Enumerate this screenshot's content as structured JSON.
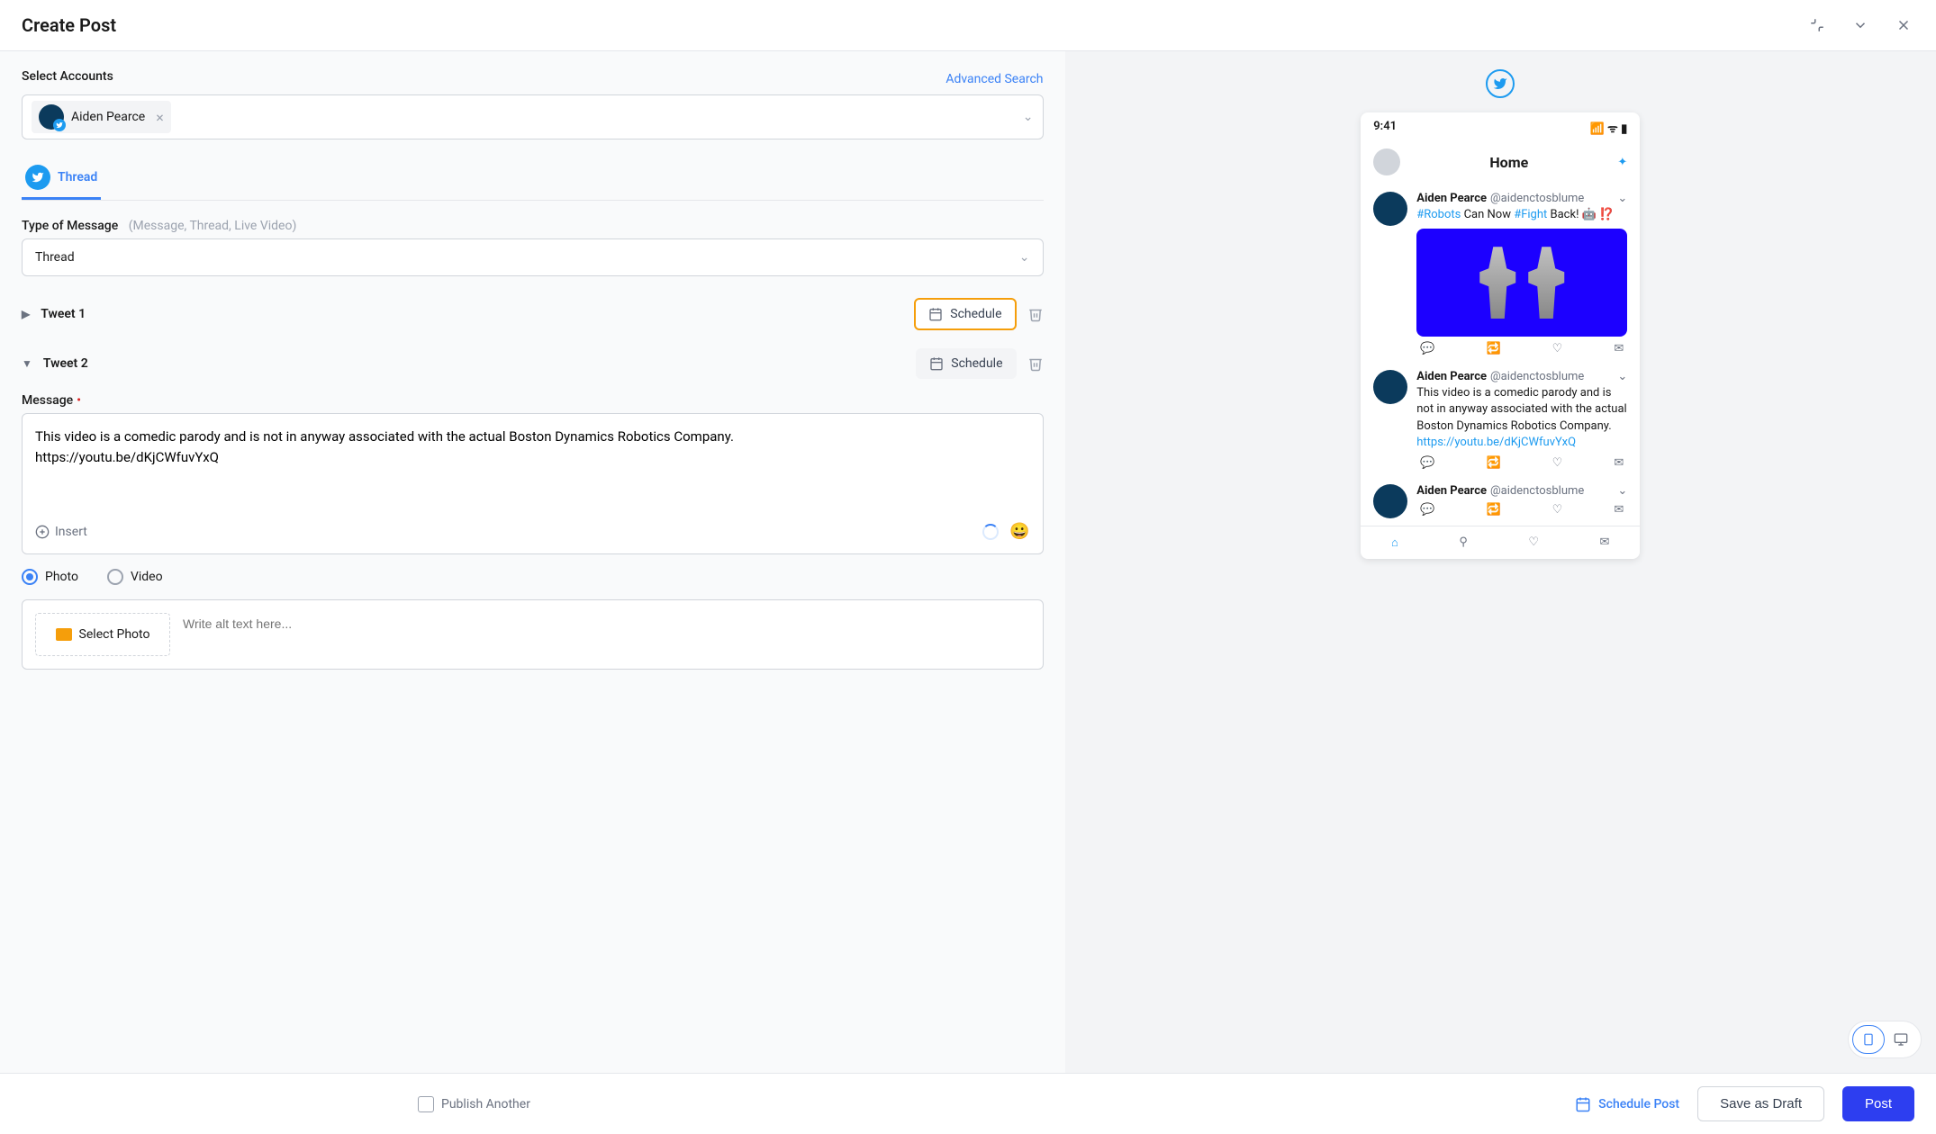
{
  "header": {
    "title": "Create Post"
  },
  "accounts": {
    "label": "Select Accounts",
    "advanced": "Advanced Search",
    "selected_name": "Aiden Pearce"
  },
  "tab": {
    "label": "Thread"
  },
  "type": {
    "label": "Type of Message",
    "hint": "(Message, Thread, Live Video)",
    "value": "Thread"
  },
  "tweets": {
    "t1_label": "Tweet 1",
    "t2_label": "Tweet 2",
    "schedule": "Schedule"
  },
  "message": {
    "label": "Message",
    "text": "This video is a comedic parody and is not in anyway associated with the actual Boston Dynamics Robotics Company.\nhttps://youtu.be/dKjCWfuvYxQ",
    "insert": "Insert"
  },
  "media": {
    "photo": "Photo",
    "video": "Video",
    "select_photo": "Select Photo",
    "alt_placeholder": "Write alt text here..."
  },
  "preview": {
    "time": "9:41",
    "home": "Home",
    "name": "Aiden Pearce",
    "handle": "@aidenctosblume",
    "tweet1_a": "#Robots",
    "tweet1_b": " Can Now ",
    "tweet1_c": "#Fight",
    "tweet1_d": " Back! 🤖 ⁉️",
    "tweet2_text": "This video is a comedic parody and is not in anyway associated with the actual Boston Dynamics Robotics Company.",
    "tweet2_url": "https://youtu.be/dKjCWfuvYxQ"
  },
  "footer": {
    "publish_another": "Publish Another",
    "schedule_post": "Schedule Post",
    "save_draft": "Save as Draft",
    "post": "Post"
  }
}
